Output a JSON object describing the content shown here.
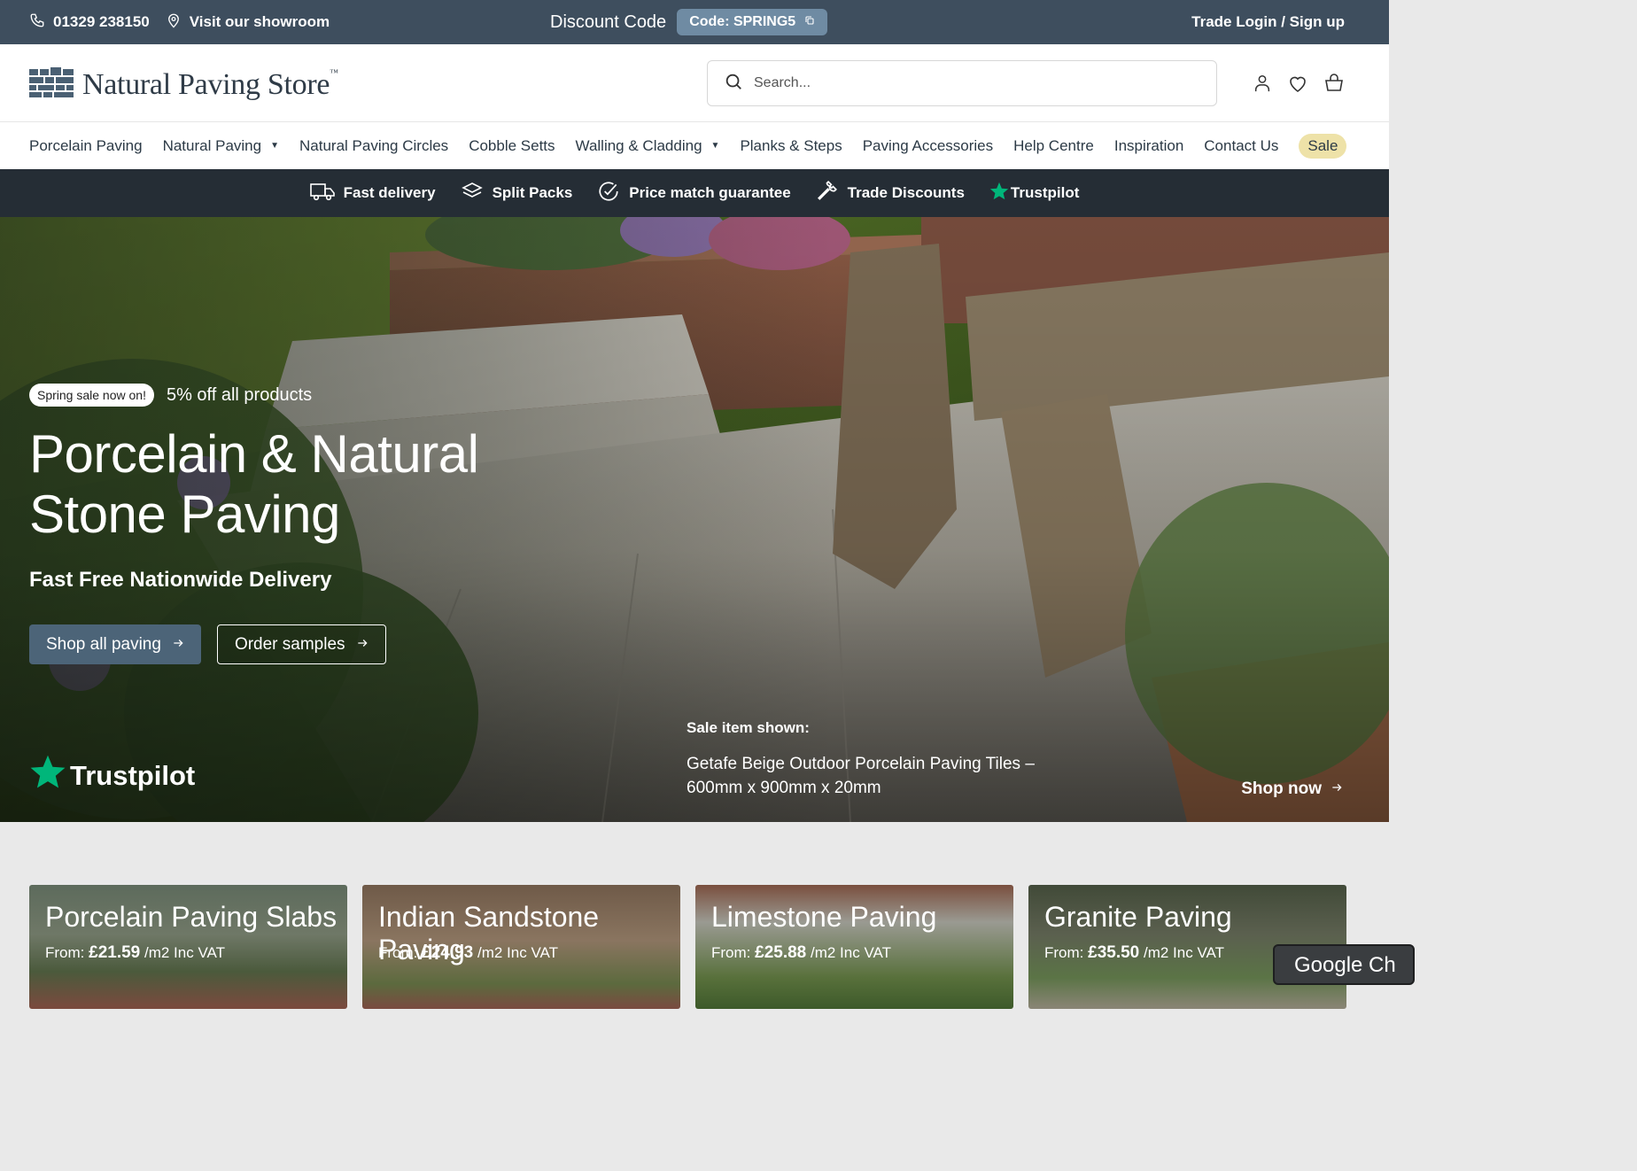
{
  "topbar": {
    "phone": "01329 238150",
    "showroom": "Visit our showroom",
    "discount_label": "Discount Code",
    "discount_code": "Code: SPRING5",
    "trade_login": "Trade Login / Sign up"
  },
  "header": {
    "logo_text": "Natural Paving Store",
    "logo_tm": "™",
    "search_placeholder": "Search..."
  },
  "nav": {
    "items": [
      {
        "label": "Porcelain Paving"
      },
      {
        "label": "Natural Paving"
      },
      {
        "label": "Natural Paving Circles"
      },
      {
        "label": "Cobble Setts"
      },
      {
        "label": "Walling & Cladding"
      },
      {
        "label": "Planks & Steps"
      },
      {
        "label": "Paving Accessories"
      },
      {
        "label": "Help Centre"
      },
      {
        "label": "Inspiration"
      },
      {
        "label": "Contact Us"
      },
      {
        "label": "Sale"
      }
    ]
  },
  "usp": {
    "fast_delivery": "Fast delivery",
    "split_packs": "Split Packs",
    "price_match": "Price match guarantee",
    "trade_discounts": "Trade Discounts",
    "trustpilot": "Trustpilot"
  },
  "hero": {
    "sale_badge": "Spring sale now on!",
    "sale_text": "5% off all products",
    "title": "Porcelain & Natural Stone Paving",
    "subtitle": "Fast Free Nationwide Delivery",
    "btn_shop": "Shop all paving",
    "btn_samples": "Order samples",
    "trustpilot": "Trustpilot",
    "sale_shown_label": "Sale item shown:",
    "sale_shown_name": "Getafe Beige Outdoor Porcelain Paving Tiles – 600mm x 900mm x 20mm",
    "shop_now": "Shop now"
  },
  "categories": [
    {
      "title": "Porcelain Paving Slabs",
      "from": "From:",
      "price": "£21.59",
      "unit": "/m2 Inc VAT"
    },
    {
      "title": "Indian Sandstone Paving",
      "from": "From:",
      "price": "£24.93",
      "unit": "/m2 Inc VAT"
    },
    {
      "title": "Limestone Paving",
      "from": "From:",
      "price": "£25.88",
      "unit": "/m2 Inc VAT"
    },
    {
      "title": "Granite Paving",
      "from": "From:",
      "price": "£35.50",
      "unit": "/m2 Inc VAT"
    }
  ],
  "overlay": {
    "google_chip": "Google Ch"
  },
  "colors": {
    "topbar": "#3e4e5e",
    "usp_bar": "#252d35",
    "primary_button": "#4c6478",
    "sale_pill": "#eee2a8",
    "trustpilot_star": "#00b67a"
  }
}
